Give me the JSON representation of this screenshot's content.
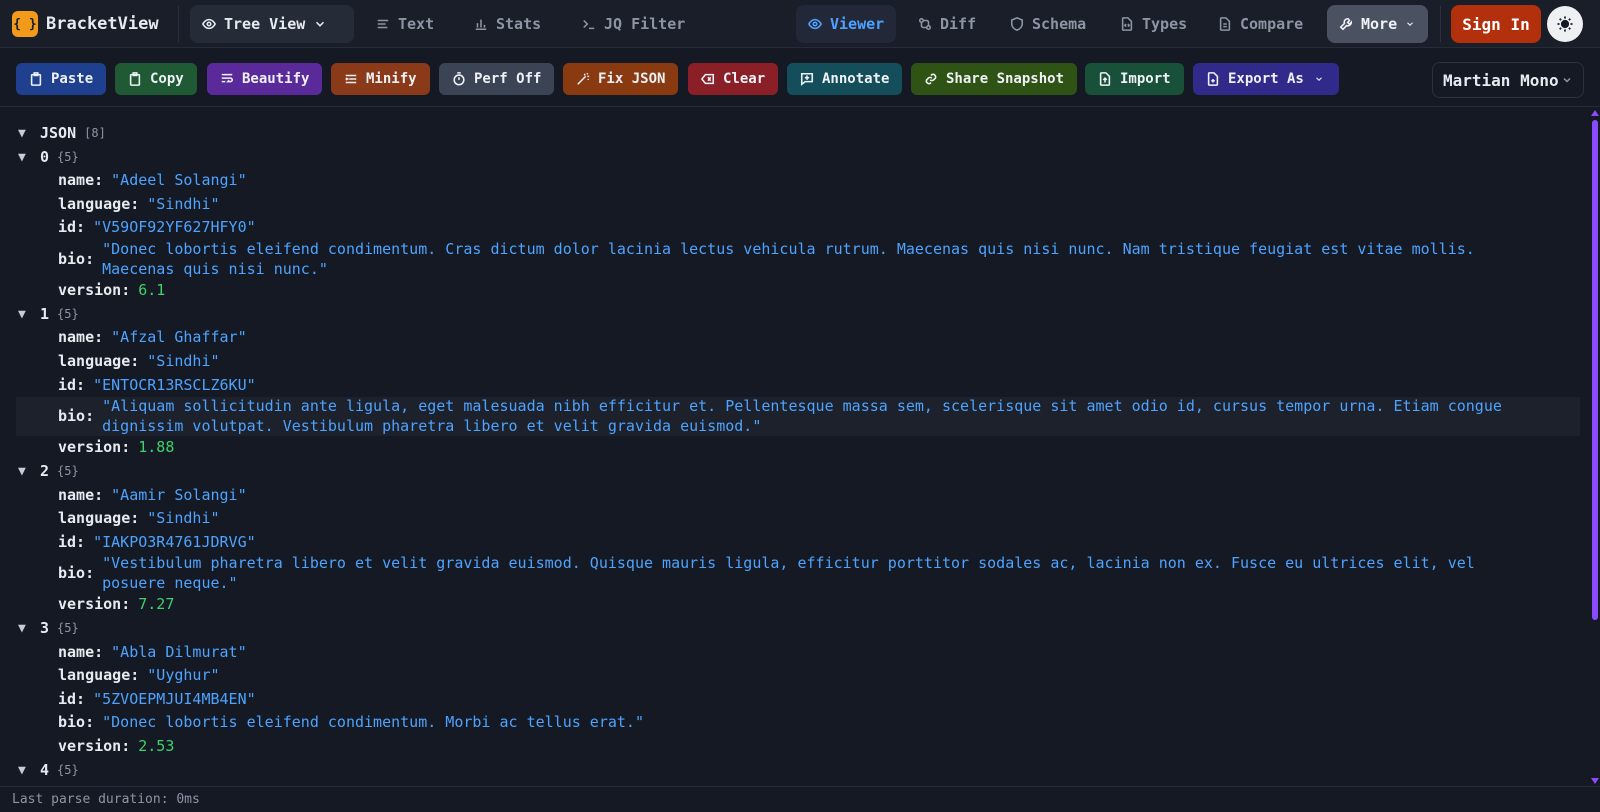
{
  "app": {
    "name": "BracketView",
    "logo_glyph": "{ }"
  },
  "nav": {
    "view_mode": "Tree View",
    "text": "Text",
    "stats": "Stats",
    "jq": "JQ Filter",
    "viewer": "Viewer",
    "diff": "Diff",
    "schema": "Schema",
    "types": "Types",
    "compare": "Compare",
    "more": "More",
    "sign_in": "Sign In"
  },
  "toolbar": {
    "paste": "Paste",
    "copy": "Copy",
    "beautify": "Beautify",
    "minify": "Minify",
    "perf": "Perf Off",
    "fix": "Fix JSON",
    "clear": "Clear",
    "annotate": "Annotate",
    "share": "Share Snapshot",
    "import": "Import",
    "export": "Export As",
    "font": "Martian Mono"
  },
  "colors": {
    "paste": "#1f3f8f",
    "copy": "#1f5a34",
    "beautify": "#5a2a9a",
    "minify": "#8a3a18",
    "perf": "#3b4454",
    "fix": "#8a3a10",
    "clear": "#8a1f28",
    "annotate": "#134e5a",
    "share": "#2f5314",
    "import": "#18503a",
    "export": "#302a8a"
  },
  "tree": {
    "root_key": "JSON",
    "root_count": "[8]",
    "items": [
      {
        "index": "0",
        "count": "{5}",
        "name": "\"Adeel Solangi\"",
        "language": "\"Sindhi\"",
        "id": "\"V59OF92YF627HFY0\"",
        "bio": "\"Donec lobortis eleifend condimentum. Cras dictum dolor lacinia lectus vehicula rutrum. Maecenas quis nisi nunc. Nam tristique feugiat est vitae mollis. Maecenas quis nisi nunc.\"",
        "version": "6.1"
      },
      {
        "index": "1",
        "count": "{5}",
        "name": "\"Afzal Ghaffar\"",
        "language": "\"Sindhi\"",
        "id": "\"ENTOCR13RSCLZ6KU\"",
        "bio": "\"Aliquam sollicitudin ante ligula, eget malesuada nibh efficitur et. Pellentesque massa sem, scelerisque sit amet odio id, cursus tempor urna. Etiam congue dignissim volutpat. Vestibulum pharetra libero et velit gravida euismod.\"",
        "version": "1.88"
      },
      {
        "index": "2",
        "count": "{5}",
        "name": "\"Aamir Solangi\"",
        "language": "\"Sindhi\"",
        "id": "\"IAKPO3R4761JDRVG\"",
        "bio": "\"Vestibulum pharetra libero et velit gravida euismod. Quisque mauris ligula, efficitur porttitor sodales ac, lacinia non ex. Fusce eu ultrices elit, vel posuere neque.\"",
        "version": "7.27"
      },
      {
        "index": "3",
        "count": "{5}",
        "name": "\"Abla Dilmurat\"",
        "language": "\"Uyghur\"",
        "id": "\"5ZVOEPMJUI4MB4EN\"",
        "bio": "\"Donec lobortis eleifend condimentum. Morbi ac tellus erat.\"",
        "version": "2.53"
      },
      {
        "index": "4",
        "count": "{5}"
      }
    ],
    "labels": {
      "name": "name:",
      "language": "language:",
      "id": "id:",
      "bio": "bio:",
      "version": "version:"
    }
  },
  "status": {
    "parse": "Last parse duration: 0ms"
  }
}
